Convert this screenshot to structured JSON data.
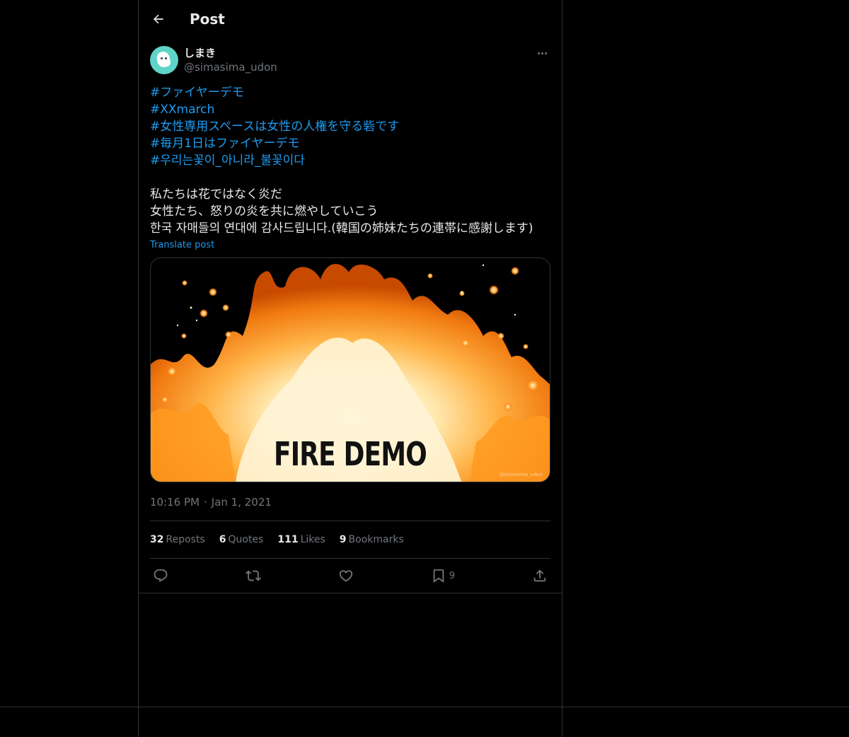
{
  "header": {
    "title": "Post"
  },
  "post": {
    "author": {
      "display_name": "しまき",
      "handle": "@simasima_udon"
    },
    "hashtags": [
      "#ファイヤーデモ",
      "#XXmarch",
      "#女性専用スペースは女性の人権を守る砦です",
      "#毎月1日はファイヤーデモ",
      "#우리는꽃이_아니라_불꽃이다"
    ],
    "lines": [
      "私たちは花ではなく炎だ",
      "女性たち、怒りの炎を共に燃やしていこう",
      "한국 자매들의 연대에 감사드립니다.(韓国の姉妹たちの連帯に感謝します)"
    ],
    "translate_label": "Translate post",
    "image": {
      "caption": "FIRE DEMO",
      "watermark": "@simasima_udon"
    },
    "time": "10:16 PM",
    "date": "Jan 1, 2021",
    "separator": "·",
    "stats": {
      "reposts_count": "32",
      "reposts_label": "Reposts",
      "quotes_count": "6",
      "quotes_label": "Quotes",
      "likes_count": "111",
      "likes_label": "Likes",
      "bookmarks_count": "9",
      "bookmarks_label": "Bookmarks"
    },
    "actions": {
      "reply_icon": "reply-icon",
      "repost_icon": "repost-icon",
      "like_icon": "heart-icon",
      "bookmark_icon": "bookmark-icon",
      "bookmark_count": "9",
      "share_icon": "share-icon"
    }
  },
  "colors": {
    "background": "#000000",
    "link": "#1d9bf0",
    "muted": "#71767b",
    "text": "#e7e9ea",
    "border": "#2f3336"
  }
}
